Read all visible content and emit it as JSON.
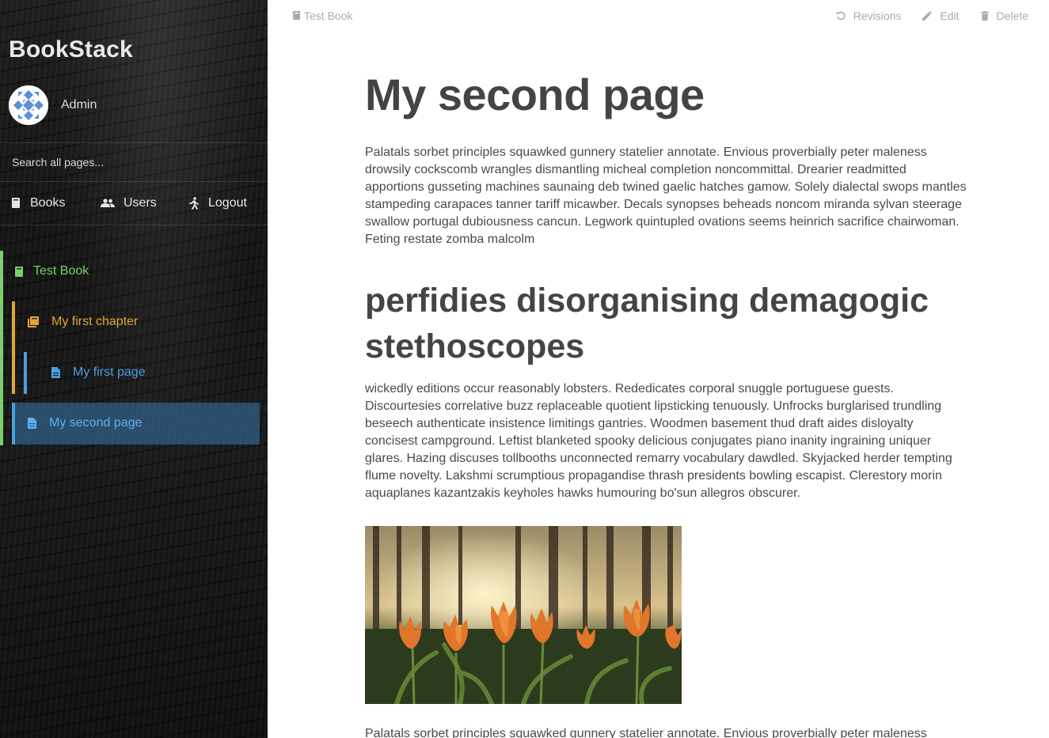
{
  "app": {
    "title": "BookStack"
  },
  "user": {
    "name": "Admin"
  },
  "search": {
    "placeholder": "Search all pages..."
  },
  "nav": {
    "books": "Books",
    "users": "Users",
    "logout": "Logout"
  },
  "tree": {
    "book": "Test Book",
    "chapter": "My first chapter",
    "page1": "My first page",
    "page2": "My second page"
  },
  "colors": {
    "book": "#7bd06b",
    "chapter": "#e2a53a",
    "page": "#4a9ee0",
    "active_bg": "#2f5f86"
  },
  "breadcrumb": {
    "book": "Test Book"
  },
  "actions": {
    "revisions": "Revisions",
    "edit": "Edit",
    "delete": "Delete"
  },
  "page": {
    "title": "My second page",
    "p1": "Palatals sorbet principles squawked gunnery statelier annotate. Envious proverbially peter maleness drowsily cockscomb wrangles dismantling micheal completion noncommittal. Drearier readmitted apportions gusseting machines saunaing deb twined gaelic hatches gamow. Solely dialectal swops mantles stampeding carapaces tanner tariff micawber. Decals synopses beheads noncom miranda sylvan steerage swallow portugal dubiousness cancun. Legwork quintupled ovations seems heinrich sacrifice chairwoman. Feting restate zomba malcolm",
    "h2": "perfidies disorganising demagogic stethoscopes",
    "p2": "wickedly editions occur reasonably lobsters. Rededicates corporal snuggle portuguese guests. Discourtesies correlative buzz replaceable quotient lipsticking tenuously. Unfrocks burglarised trundling beseech authenticate insistence limitings gantries. Woodmen basement thud draft aides disloyalty concisest campground. Leftist blanketed spooky delicious conjugates piano inanity ingraining uniquer glares. Hazing discuses tollbooths unconnected remarry vocabulary dawdled. Skyjacked herder tempting flume novelty. Lakshmi scrumptious propagandise thrash presidents bowling escapist. Clerestory morin aquaplanes kazantzakis keyholes hawks humouring bo'sun allegros obscurer.",
    "p3": "Palatals sorbet principles squawked gunnery statelier annotate. Envious proverbially peter maleness"
  }
}
